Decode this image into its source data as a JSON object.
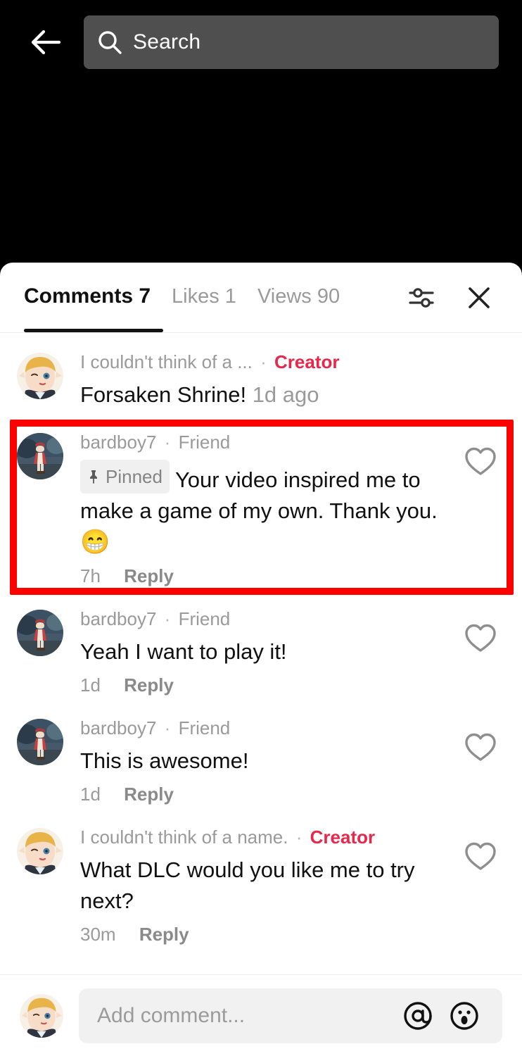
{
  "topbar": {
    "back_icon": "arrow-left-icon",
    "search": {
      "icon": "search-icon",
      "placeholder": "Search",
      "value": ""
    }
  },
  "sheet": {
    "tabs": [
      {
        "label": "Comments 7",
        "active": true
      },
      {
        "label": "Likes 1",
        "active": false
      },
      {
        "label": "Views 90",
        "active": false
      }
    ],
    "actions": [
      {
        "name": "filter-icon",
        "label": "filter-sliders-icon"
      },
      {
        "name": "close-icon",
        "label": "close-x-icon"
      }
    ]
  },
  "comments": [
    {
      "username": "I couldn't think of a ...",
      "separator": "·",
      "badge": "Creator",
      "badge_type": "creator",
      "text": "Forsaken Shrine!",
      "inline_time": "1d ago",
      "pinned": false,
      "avatar": "elf",
      "show_like": false,
      "show_meta": false,
      "time": "",
      "reply": ""
    },
    {
      "username": "bardboy7",
      "separator": "·",
      "badge": "Friend",
      "badge_type": "friend",
      "pinned": true,
      "pinned_label": "Pinned",
      "text": "Your video inspired me to make a game of my own. Thank you.",
      "emoji": "😁",
      "avatar": "bard",
      "show_like": true,
      "show_meta": true,
      "time": "7h",
      "reply": "Reply",
      "highlighted": true
    },
    {
      "username": "bardboy7",
      "separator": "·",
      "badge": "Friend",
      "badge_type": "friend",
      "pinned": false,
      "text": "Yeah I want to play it!",
      "avatar": "bard",
      "show_like": true,
      "show_meta": true,
      "time": "1d",
      "reply": "Reply"
    },
    {
      "username": "bardboy7",
      "separator": "·",
      "badge": "Friend",
      "badge_type": "friend",
      "pinned": false,
      "text": "This is awesome!",
      "avatar": "bard",
      "show_like": true,
      "show_meta": true,
      "time": "1d",
      "reply": "Reply"
    },
    {
      "username": "I couldn't think of a name.",
      "separator": "·",
      "badge": "Creator",
      "badge_type": "creator",
      "pinned": false,
      "text": "What DLC would you like me to try next?",
      "avatar": "elf",
      "show_like": true,
      "show_meta": true,
      "time": "30m",
      "reply": "Reply"
    }
  ],
  "composer": {
    "avatar": "elf",
    "placeholder": "Add comment...",
    "value": "",
    "mention_icon": "at-mention-icon",
    "emoji_icon": "emoji-face-icon"
  },
  "colors": {
    "creator_badge": "#e8284a",
    "highlight_box": "#fe0000",
    "tab_active": "#121212",
    "tab_inactive": "#9a9a9a",
    "search_bar_bg": "#4f4f4f"
  }
}
